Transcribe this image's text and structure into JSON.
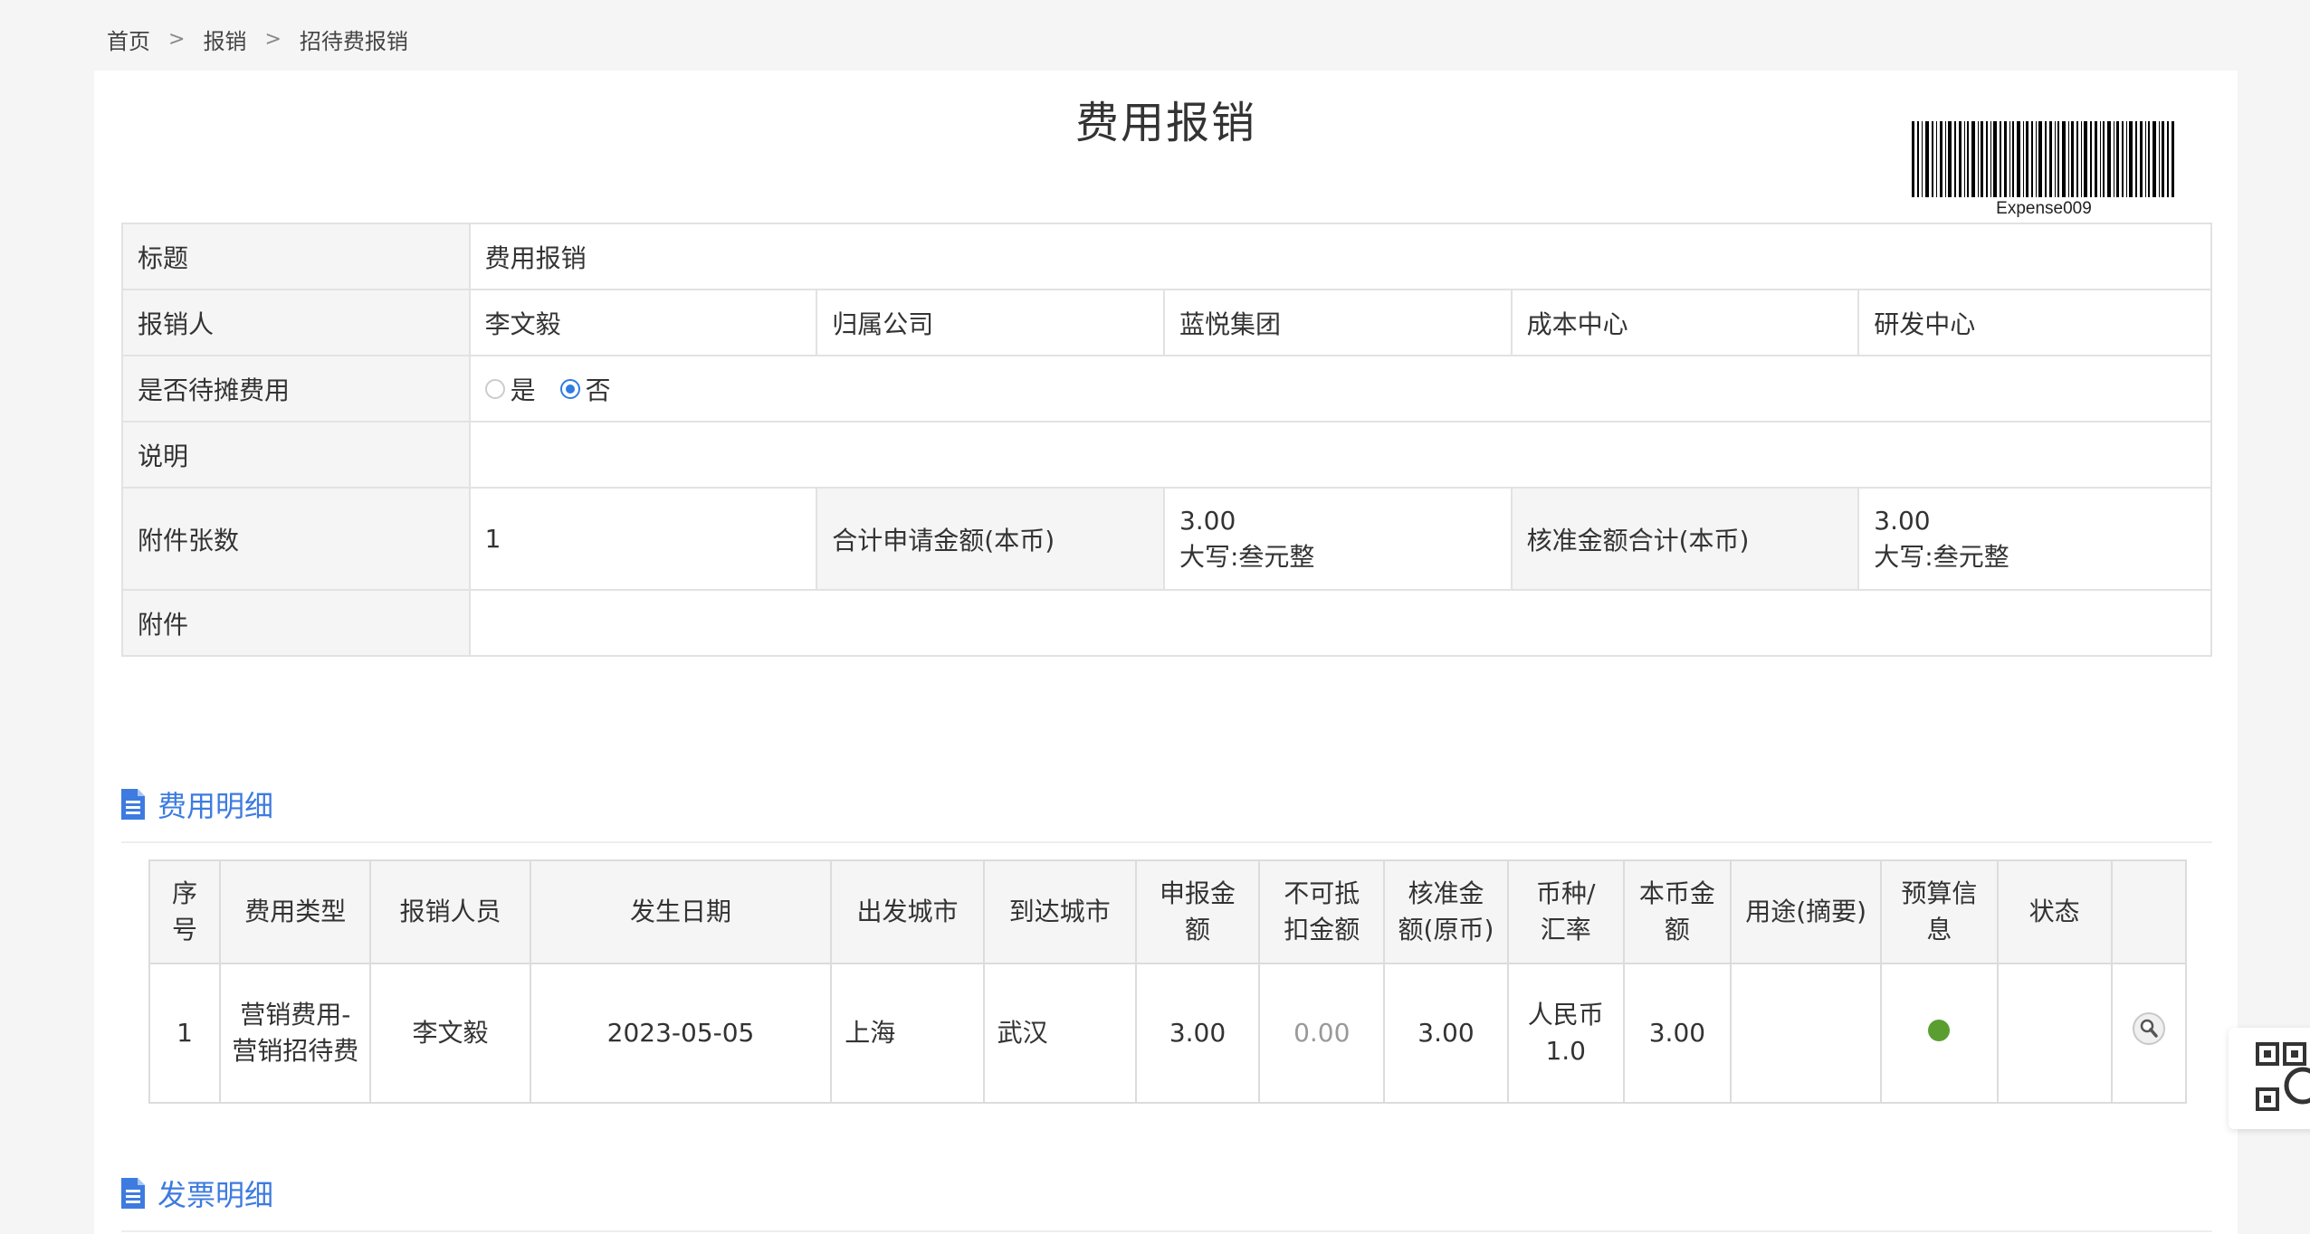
{
  "breadcrumb": {
    "home": "首页",
    "level2": "报销",
    "current": "招待费报销"
  },
  "page": {
    "title": "费用报销",
    "barcode_text": "Expense009"
  },
  "form": {
    "title_label": "标题",
    "title_value": "费用报销",
    "claimant_label": "报销人",
    "claimant_value": "李文毅",
    "company_label": "归属公司",
    "company_value": "蓝悦集团",
    "cost_center_label": "成本中心",
    "cost_center_value": "研发中心",
    "amortize_label": "是否待摊费用",
    "amortize_yes": "是",
    "amortize_no": "否",
    "amortize_selected": "否",
    "desc_label": "说明",
    "desc_value": "",
    "attach_count_label": "附件张数",
    "attach_count_value": "1",
    "total_apply_label": "合计申请金额(本币)",
    "total_apply_value": "3.00",
    "total_apply_words": "大写:叁元整",
    "total_approved_label": "核准金额合计(本币)",
    "total_approved_value": "3.00",
    "total_approved_words": "大写:叁元整",
    "attachment_label": "附件",
    "attachment_value": ""
  },
  "expense_section": {
    "title": "费用明细"
  },
  "expense_table": {
    "headers": [
      "序\n号",
      "费用类型",
      "报销人员",
      "发生日期",
      "出发城市",
      "到达城市",
      "申报金\n额",
      "不可抵\n扣金额",
      "核准金\n额(原币)",
      "币种/\n汇率",
      "本币金\n额",
      "用途(摘要)",
      "预算信\n息",
      "状态",
      ""
    ],
    "rows": [
      {
        "no": "1",
        "type": "营销费用-营销招待费",
        "person": "李文毅",
        "date": "2023-05-05",
        "from": "上海",
        "to": "武汉",
        "amount": "3.00",
        "non_deductible": "0.00",
        "approved": "3.00",
        "currency": "人民币",
        "rate": "1.0",
        "local_amount": "3.00",
        "purpose": "",
        "budget_status_color": "#5a9e32",
        "status": ""
      }
    ]
  },
  "invoice_section": {
    "title": "发票明细"
  },
  "colors": {
    "accent": "#3d7be0",
    "radio": "#2f7de1",
    "budget_ok": "#5a9e32"
  }
}
